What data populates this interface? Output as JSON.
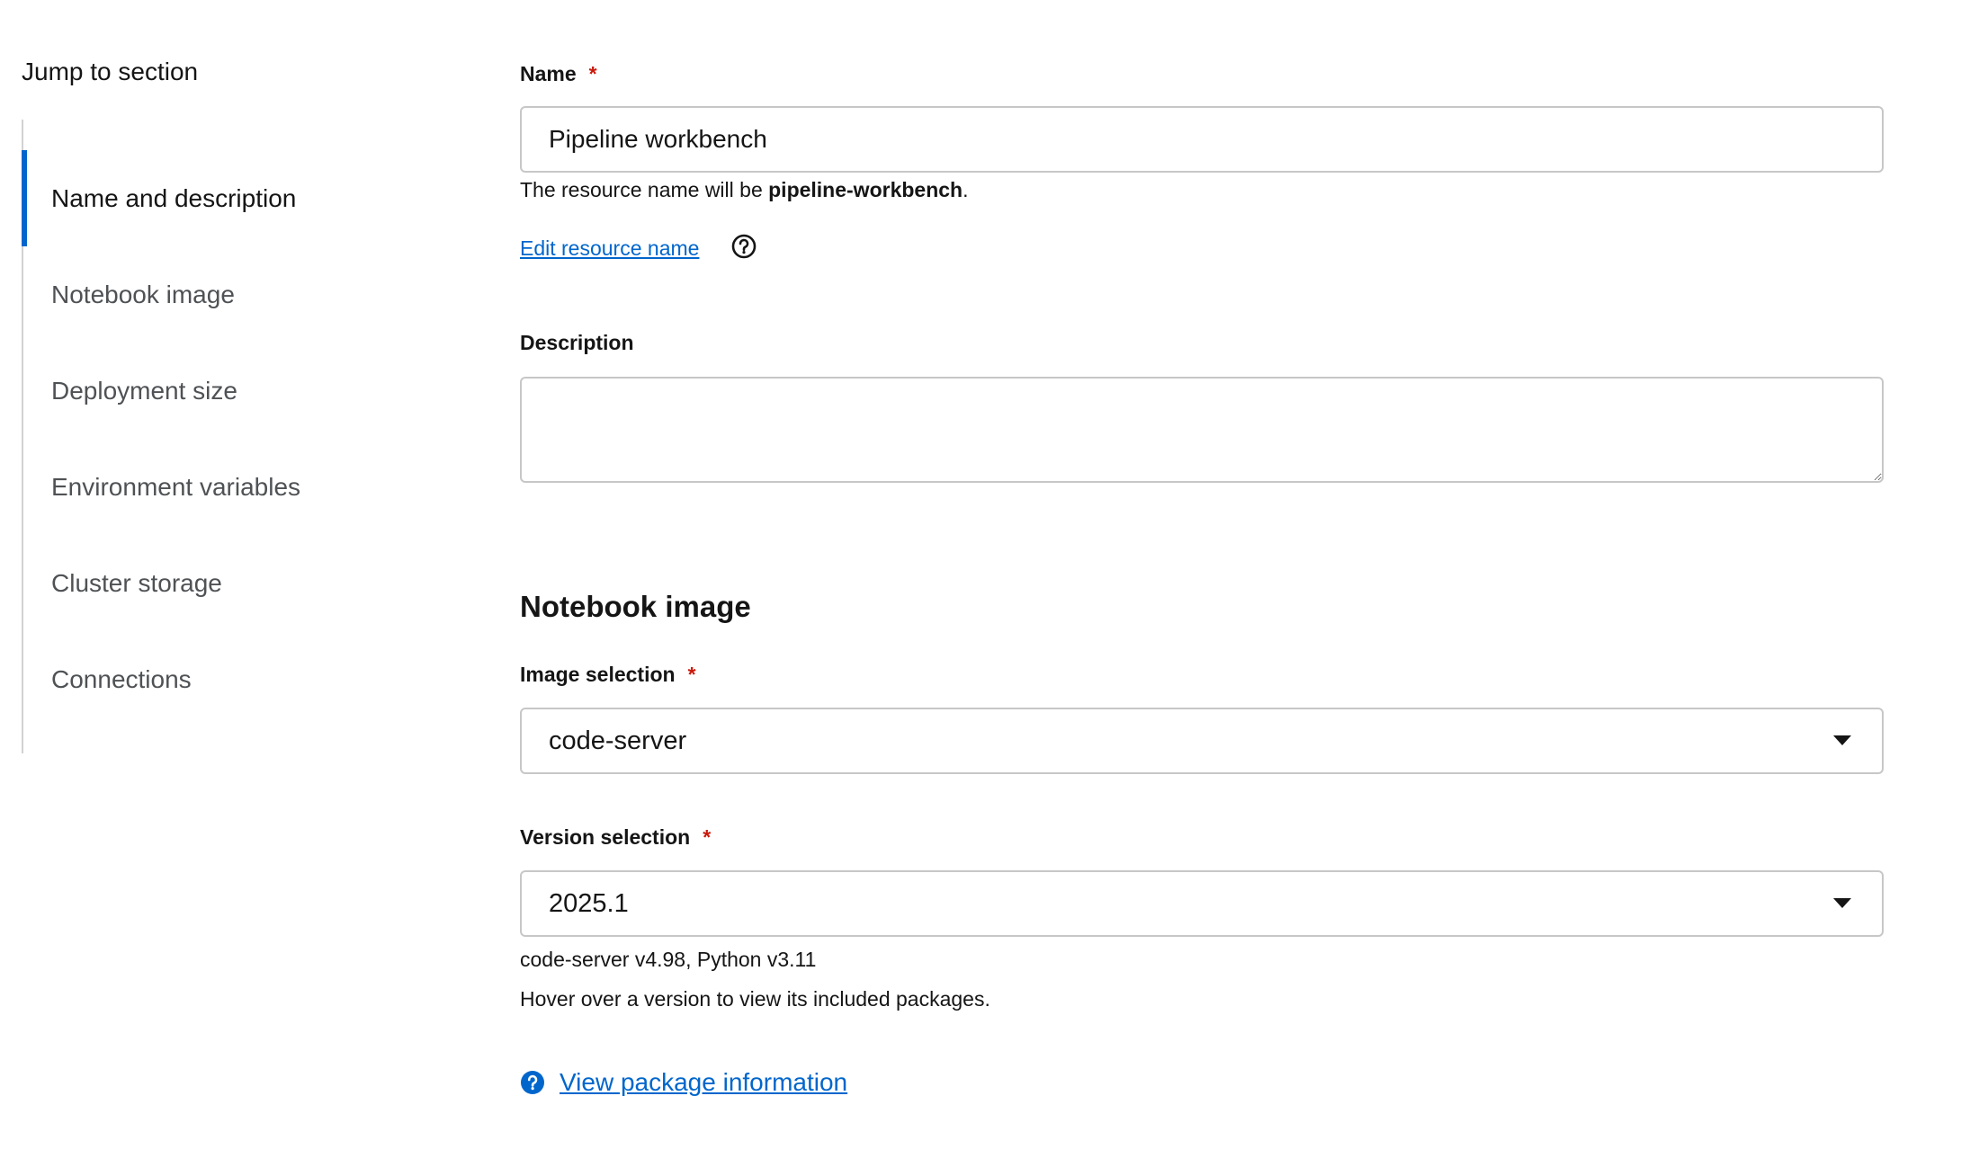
{
  "jump": {
    "title": "Jump to section",
    "items": [
      {
        "label": "Name and description"
      },
      {
        "label": "Notebook image"
      },
      {
        "label": "Deployment size"
      },
      {
        "label": "Environment variables"
      },
      {
        "label": "Cluster storage"
      },
      {
        "label": "Connections"
      }
    ]
  },
  "form": {
    "name": {
      "label": "Name",
      "required_marker": "*",
      "value": "Pipeline workbench",
      "helper_prefix": "The resource name will be ",
      "resource_name": "pipeline-workbench",
      "helper_suffix": "."
    },
    "edit_resource_name": "Edit resource name",
    "description": {
      "label": "Description",
      "value": ""
    },
    "notebook_image": {
      "heading": "Notebook image",
      "image_selection": {
        "label": "Image selection",
        "required_marker": "*",
        "value": "code-server"
      },
      "version_selection": {
        "label": "Version selection",
        "required_marker": "*",
        "value": "2025.1",
        "detail": "code-server v4.98, Python v3.11",
        "hint": "Hover over a version to view its included packages."
      },
      "package_link": "View package information"
    }
  },
  "colors": {
    "accent": "#0066cc",
    "required": "#c9190b",
    "border": "#c7c7c7"
  },
  "icons": [
    "help-circle-outline-icon",
    "caret-down-icon",
    "help-circle-filled-icon"
  ]
}
